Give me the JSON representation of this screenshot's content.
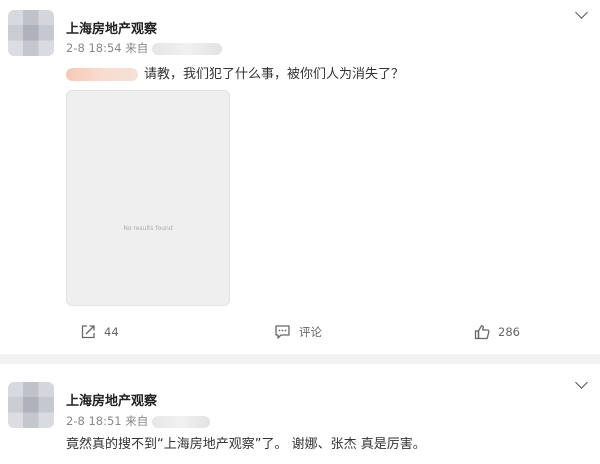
{
  "posts": [
    {
      "author": "上海房地产观察",
      "time": "2-8 18:54",
      "source_prefix": "来自",
      "text": "请教，我们犯了什么事，被你们人为消失了？",
      "image_caption": "No results found",
      "actions": {
        "repost": "44",
        "comment": "评论",
        "like": "286"
      }
    },
    {
      "author": "上海房地产观察",
      "time": "2-8 18:51",
      "source_prefix": "来自",
      "text": "竟然真的搜不到“上海房地产观察”了。 谢娜、张杰 真是厉害。"
    }
  ],
  "icons": {
    "menu": "chevron-down-icon",
    "repost": "repost-icon",
    "comment": "comment-icon",
    "like": "thumbs-up-icon"
  }
}
